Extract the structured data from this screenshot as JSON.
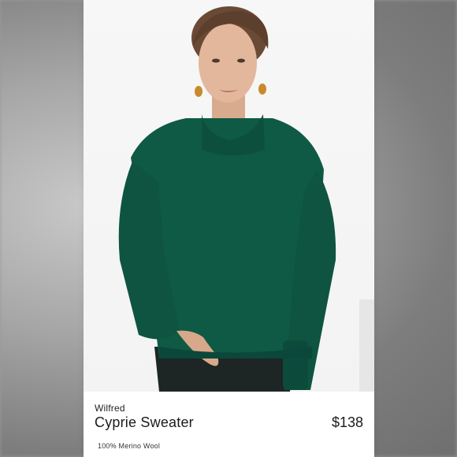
{
  "listing": {
    "brand": "Wilfred",
    "title": "Cyprie Sweater",
    "price": "$138",
    "material": "100% Merino Wool"
  },
  "colors": {
    "sweater": "#0f5a45",
    "background": "#f5f5f5",
    "text": "#1b1b1b"
  },
  "image": {
    "subject": "model wearing green turtleneck sweater",
    "icon": "product-photo"
  }
}
